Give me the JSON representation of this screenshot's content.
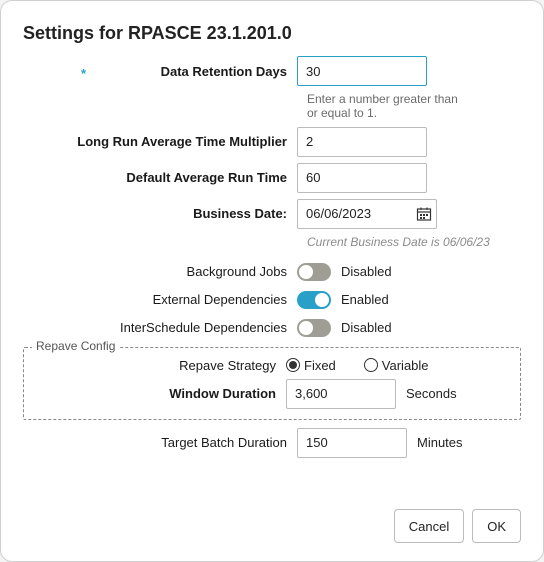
{
  "title": "Settings for RPASCE 23.1.201.0",
  "fields": {
    "retention": {
      "label": "Data Retention Days",
      "value": "30",
      "hint": "Enter a number greater than or equal to 1."
    },
    "multiplier": {
      "label": "Long Run Average Time Multiplier",
      "value": "2"
    },
    "avgRun": {
      "label": "Default Average Run Time",
      "value": "60"
    },
    "bizDate": {
      "label": "Business Date:",
      "value": "06/06/2023",
      "hint": "Current Business Date is 06/06/23"
    },
    "bgJobs": {
      "label": "Background Jobs",
      "state": "Disabled"
    },
    "extDeps": {
      "label": "External Dependencies",
      "state": "Enabled"
    },
    "interDeps": {
      "label": "InterSchedule Dependencies",
      "state": "Disabled"
    },
    "repave": {
      "legend": "Repave Config",
      "strategyLabel": "Repave Strategy",
      "opt1": "Fixed",
      "opt2": "Variable",
      "windowLabel": "Window Duration",
      "windowValue": "3,600",
      "windowUnit": "Seconds"
    },
    "targetBatch": {
      "label": "Target Batch Duration",
      "value": "150",
      "unit": "Minutes"
    }
  },
  "buttons": {
    "cancel": "Cancel",
    "ok": "OK"
  }
}
